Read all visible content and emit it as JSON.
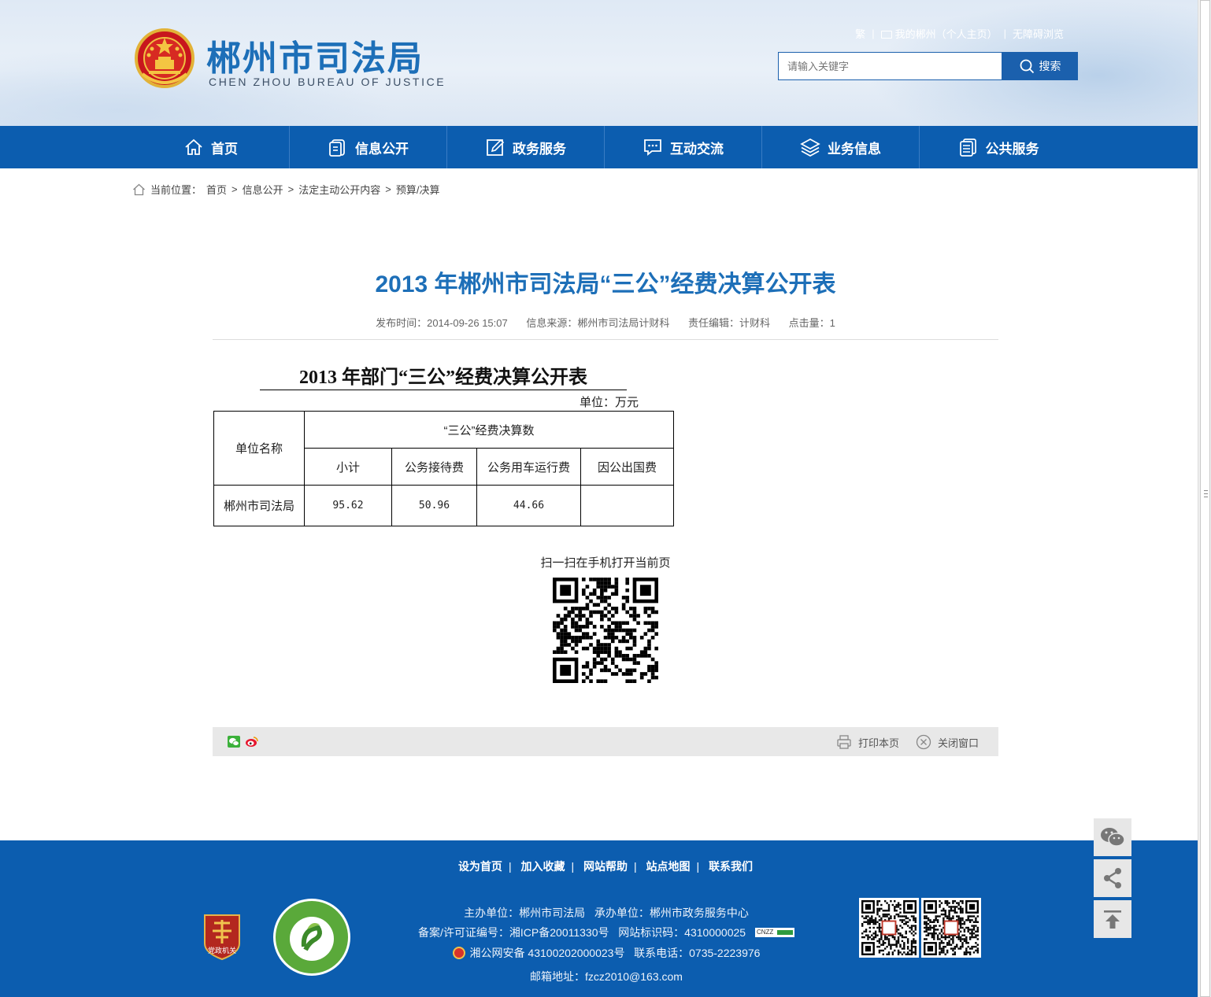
{
  "header": {
    "site_title": "郴州市司法局",
    "site_subtitle": "CHEN ZHOU BUREAU OF JUSTICE",
    "toplinks": {
      "traditional": "繁",
      "my_chenzhou": "我的郴州（个人主页）",
      "accessible": "无障碍浏览"
    },
    "search": {
      "placeholder": "请输入关键字",
      "button": "搜索"
    }
  },
  "nav": {
    "items": [
      {
        "label": "首页",
        "icon": "home-icon"
      },
      {
        "label": "信息公开",
        "icon": "document-icon"
      },
      {
        "label": "政务服务",
        "icon": "edit-icon"
      },
      {
        "label": "互动交流",
        "icon": "chat-icon"
      },
      {
        "label": "业务信息",
        "icon": "layers-icon"
      },
      {
        "label": "公共服务",
        "icon": "file-list-icon"
      }
    ]
  },
  "breadcrumb": {
    "prefix": "当前位置：",
    "items": [
      "首页",
      "信息公开",
      "法定主动公开内容",
      "预算/决算"
    ],
    "sep": ">"
  },
  "article": {
    "title": "2013 年郴州市司法局“三公”经费决算公开表",
    "meta": {
      "publish_time": "发布时间：2014-09-26 15:07",
      "source": "信息来源：郴州市司法局计财科",
      "editor": "责任编辑：计财科",
      "clicks": "点击量：1"
    }
  },
  "document": {
    "title": "2013 年部门“三公”经费决算公开表",
    "unit": "单位：万元",
    "table": {
      "header_unit": "单位名称",
      "header_group": "“三公”经费决算数",
      "columns": [
        "小计",
        "公务接待费",
        "公务用车运行费",
        "因公出国费"
      ],
      "row": {
        "name": "郴州市司法局",
        "values": [
          "95.62",
          "50.96",
          "44.66",
          ""
        ]
      }
    }
  },
  "qr": {
    "label": "扫一扫在手机打开当前页"
  },
  "toolbar": {
    "print": "打印本页",
    "close": "关闭窗口"
  },
  "footer": {
    "links": [
      "设为首页",
      "加入收藏",
      "网站帮助",
      "站点地图",
      "联系我们"
    ],
    "host": "主办单位：郴州市司法局",
    "undertaker": "承办单位：郴州市政务服务中心",
    "icp": "备案/许可证编号：湘ICP备20011330号",
    "site_id": "网站标识码：4310000025",
    "cnzz": "CNZZ",
    "police": "湘公网安备 43100202000023号",
    "phone": "联系电话：0735-2223976",
    "email": "邮箱地址：fzcz2010@163.com",
    "badge1_text": "党政机关"
  },
  "colors": {
    "brand_blue": "#0c5daf",
    "title_blue": "#1d6fb8"
  }
}
